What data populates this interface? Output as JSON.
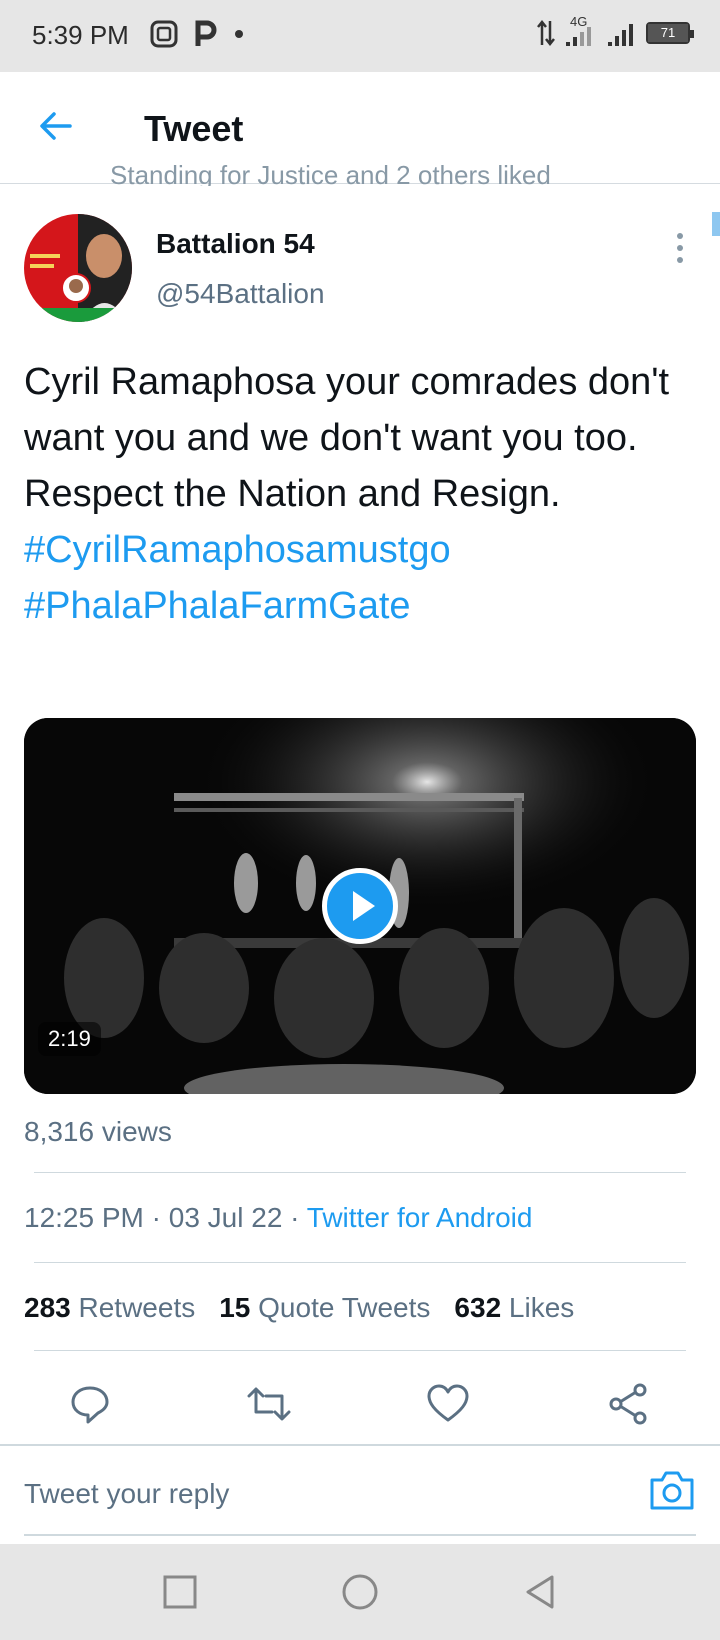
{
  "status_bar": {
    "time": "5:39 PM",
    "network": "4G",
    "battery": "71"
  },
  "header": {
    "title": "Tweet"
  },
  "context_line": "Standing for Justice and 2 others liked",
  "tweet": {
    "author_name": "Battalion 54",
    "author_handle": "@54Battalion",
    "text": "Cyril Ramaphosa your comrades don't want you and we don't want you too. Respect the Nation and Resign.",
    "hashtags": [
      "#CyrilRamaphosamustgo",
      "#PhalaPhalaFarmGate"
    ],
    "video_duration": "2:19",
    "views": "8,316 views",
    "time": "12:25 PM",
    "date": "03 Jul 22",
    "separator": "·",
    "source": "Twitter for Android",
    "stats": {
      "retweets_count": "283",
      "retweets_label": "Retweets",
      "quotes_count": "15",
      "quotes_label": "Quote Tweets",
      "likes_count": "632",
      "likes_label": "Likes"
    }
  },
  "reply": {
    "placeholder": "Tweet your reply"
  },
  "colors": {
    "accent": "#1d9bf0",
    "text_primary": "#0f1419",
    "text_secondary": "#5b7083",
    "divider": "#cfd9de"
  },
  "icons": {
    "back": "arrow-left-icon",
    "more": "more-vertical-icon",
    "play": "play-icon",
    "reply": "reply-icon",
    "retweet": "retweet-icon",
    "like": "heart-icon",
    "share": "share-icon",
    "camera": "camera-icon"
  }
}
